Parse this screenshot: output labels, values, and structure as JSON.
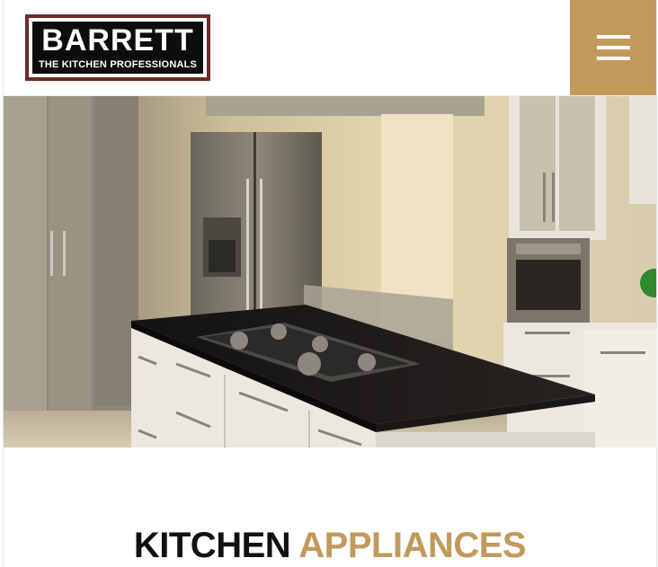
{
  "header": {
    "logo": {
      "name": "BARRETT",
      "tagline": "THE KITCHEN PROFESSIONALS"
    },
    "menu_button_icon": "hamburger-menu-icon",
    "accent_color": "#c19a5b"
  },
  "hero": {
    "image_subject": "kitchen-island-photo"
  },
  "section": {
    "title_part1": "KITCHEN",
    "title_part2": "APPLIANCES"
  }
}
